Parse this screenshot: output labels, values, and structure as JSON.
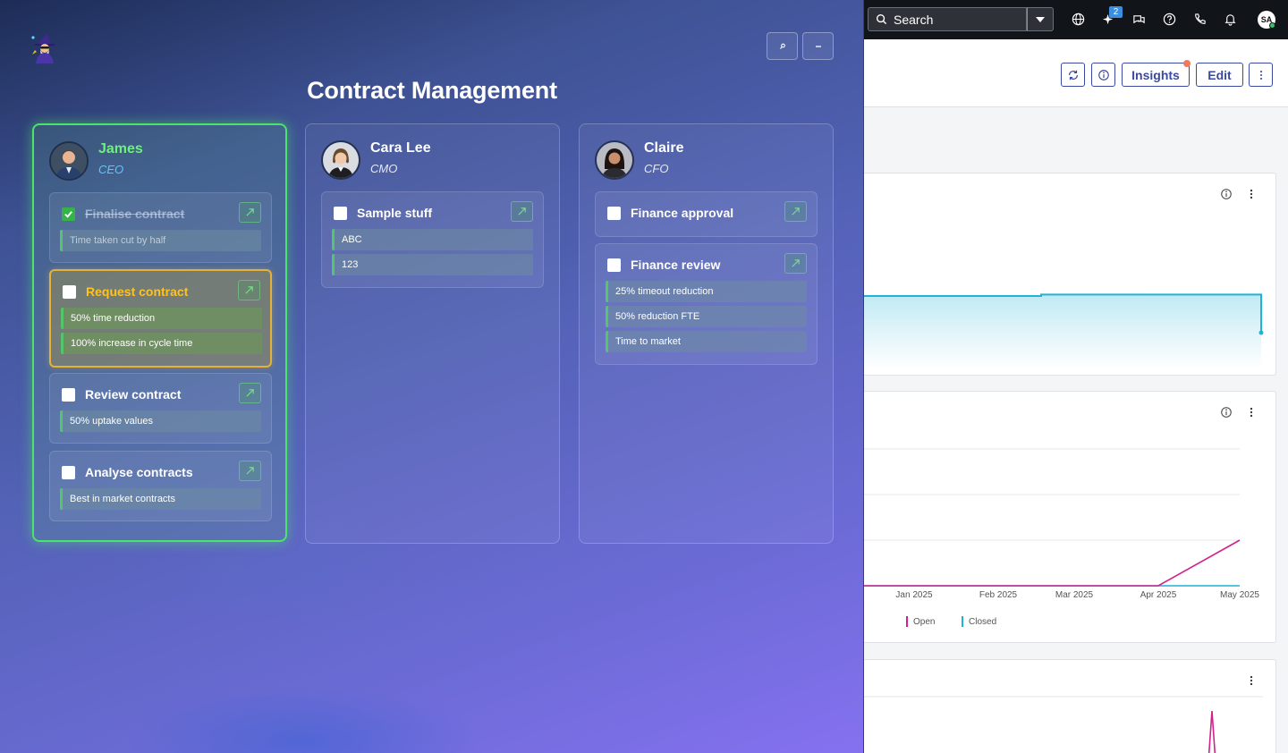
{
  "app": {
    "search": {
      "placeholder": "Search"
    },
    "notifications": {
      "ai_badge": "2"
    },
    "user": {
      "initials": "SA"
    },
    "toolbar": {
      "insights_label": "Insights",
      "edit_label": "Edit"
    },
    "colors": {
      "accent": "#3a4a9f",
      "open_series": "#d0208a",
      "closed_series": "#1fb3d6"
    }
  },
  "contract_app": {
    "title": "Contract Management",
    "columns": [
      {
        "name": "James",
        "role": "CEO",
        "tasks": [
          {
            "title": "Finalise contract",
            "done": true,
            "metrics": [
              "Time taken cut by half"
            ]
          },
          {
            "title": "Request contract",
            "done": false,
            "highlighted": true,
            "metrics": [
              "50% time reduction",
              "100% increase in cycle time"
            ]
          },
          {
            "title": "Review contract",
            "done": false,
            "metrics": [
              "50% uptake values"
            ]
          },
          {
            "title": "Analyse contracts",
            "done": false,
            "metrics": [
              "Best in market contracts"
            ]
          }
        ]
      },
      {
        "name": "Cara Lee",
        "role": "CMO",
        "tasks": [
          {
            "title": "Sample stuff",
            "done": false,
            "metrics": [
              "ABC",
              "123"
            ]
          }
        ]
      },
      {
        "name": "Claire",
        "role": "CFO",
        "tasks": [
          {
            "title": "Finance approval",
            "done": false,
            "metrics": []
          },
          {
            "title": "Finance review",
            "done": false,
            "metrics": [
              "25% timeout reduction",
              "50% reduction FTE",
              "Time to market"
            ]
          }
        ]
      }
    ]
  },
  "chart_data": [
    {
      "type": "area",
      "series": [
        {
          "color": "#1fb3d6",
          "shape": "step",
          "values": [
            1.0,
            1.0,
            1.04,
            0.0
          ]
        }
      ]
    },
    {
      "type": "line",
      "x_tick_labels": [
        "Jan 2025",
        "Feb 2025",
        "Mar 2025",
        "Apr 2025",
        "May 2025"
      ],
      "legend": [
        "Open",
        "Closed"
      ],
      "legend_placement": "bottom-left",
      "grid": true,
      "series": [
        {
          "name": "Open",
          "color": "#d0208a",
          "values": [
            0,
            0,
            0,
            0,
            1
          ]
        },
        {
          "name": "Closed",
          "color": "#1fb3d6",
          "values": [
            0,
            0,
            0,
            0,
            0
          ]
        }
      ]
    },
    {
      "type": "line",
      "series": [
        {
          "color": "#d0208a",
          "values": [
            0,
            1,
            0
          ]
        }
      ]
    }
  ]
}
